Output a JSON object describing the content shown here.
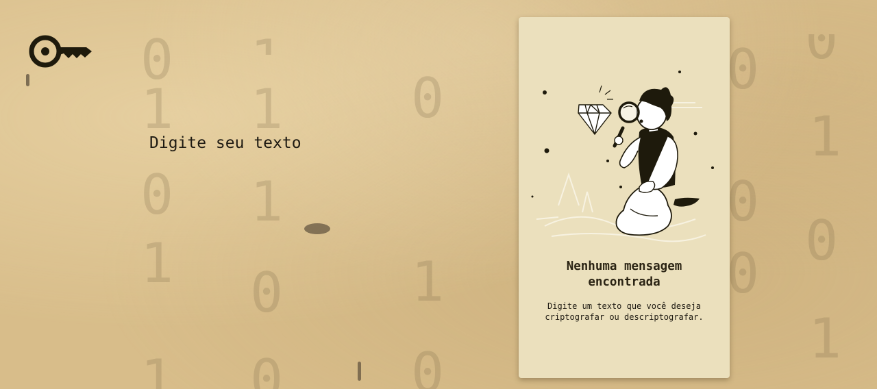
{
  "app": {
    "logo_icon": "key-icon"
  },
  "encrypt_input": {
    "placeholder": "Digite seu texto",
    "value": ""
  },
  "output_card": {
    "illustration_icon": "person-magnifier-diamond-illustration",
    "title": "Nenhuma mensagem encontrada",
    "description": "Digite um texto que você deseja criptografar ou descriptografar."
  },
  "colors": {
    "background": "#d8bd8a",
    "card_background": "#ebe0bd",
    "text_dark": "#1e1a12",
    "icon_dark": "#1e1a0c"
  }
}
